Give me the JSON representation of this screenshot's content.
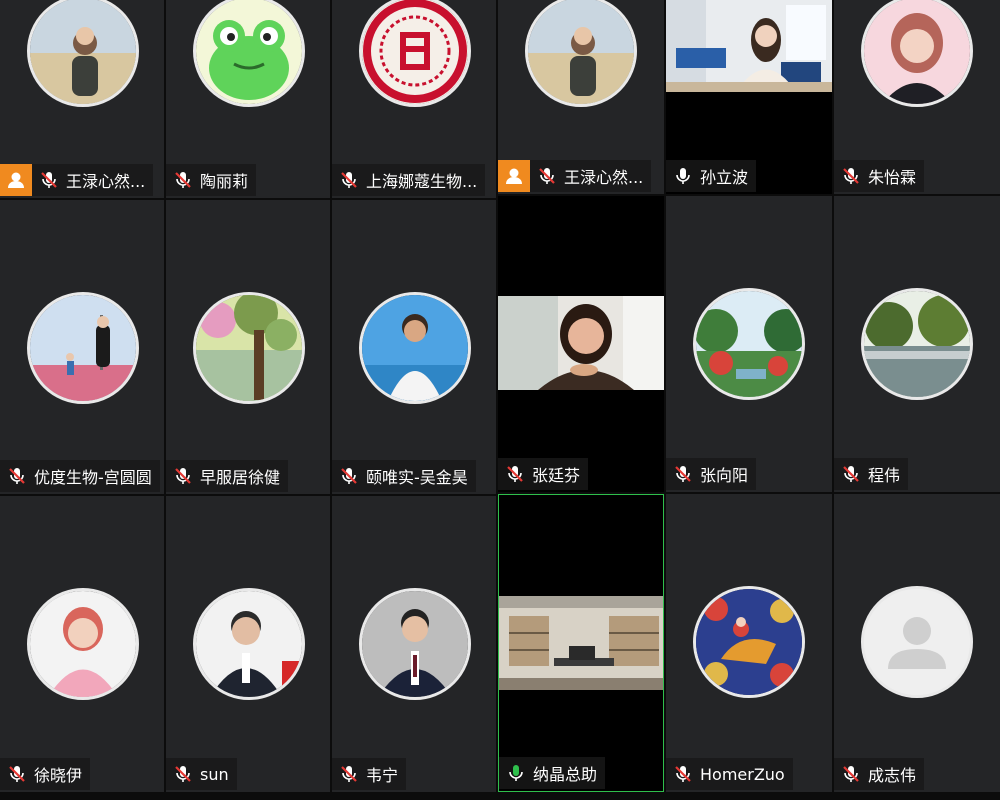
{
  "participants": [
    {
      "name": "王渌心然...",
      "host": true,
      "mic": "muted",
      "avatar": "desert-woman-photo"
    },
    {
      "name": "陶丽莉",
      "host": false,
      "mic": "muted",
      "avatar": "green-frog-cartoon"
    },
    {
      "name": "上海娜蔻生物...",
      "host": false,
      "mic": "muted",
      "avatar": "red-fu-papercut"
    },
    {
      "name": "王渌心然...",
      "host": true,
      "mic": "muted",
      "avatar": "desert-woman-photo"
    },
    {
      "name": "孙立波",
      "host": false,
      "mic": "on",
      "avatar": "video-woman-office"
    },
    {
      "name": "朱怡霖",
      "host": false,
      "mic": "muted",
      "avatar": "pink-woman-portrait"
    },
    {
      "name": "优度生物-宫圆圆",
      "host": false,
      "mic": "muted",
      "avatar": "woman-on-path"
    },
    {
      "name": "早服居徐健",
      "host": false,
      "mic": "muted",
      "avatar": "painted-tree"
    },
    {
      "name": "颐唯实-吴金昊",
      "host": false,
      "mic": "muted",
      "avatar": "man-at-sea"
    },
    {
      "name": "张廷芬",
      "host": false,
      "mic": "muted",
      "avatar": "video-woman-selfie"
    },
    {
      "name": "张向阳",
      "host": false,
      "mic": "muted",
      "avatar": "garden-landscape"
    },
    {
      "name": "程伟",
      "host": false,
      "mic": "muted",
      "avatar": "lake-reflection"
    },
    {
      "name": "徐晓伊",
      "host": false,
      "mic": "muted",
      "avatar": "woman-pink-suit"
    },
    {
      "name": "sun",
      "host": false,
      "mic": "muted",
      "avatar": "man-with-glasses"
    },
    {
      "name": "韦宁",
      "host": false,
      "mic": "muted",
      "avatar": "man-in-suit"
    },
    {
      "name": "纳晶总助",
      "host": false,
      "mic": "active",
      "avatar": "video-office-room"
    },
    {
      "name": "HomerZuo",
      "host": false,
      "mic": "muted",
      "avatar": "thangka-painting"
    },
    {
      "name": "成志伟",
      "host": false,
      "mic": "muted",
      "avatar": "default-person"
    }
  ],
  "colors": {
    "tile_bg": "#242527",
    "host_badge": "#f08a1f",
    "mic_muted": "#e53935",
    "mic_active": "#2fbf4c",
    "active_border": "#2fbf4c"
  }
}
